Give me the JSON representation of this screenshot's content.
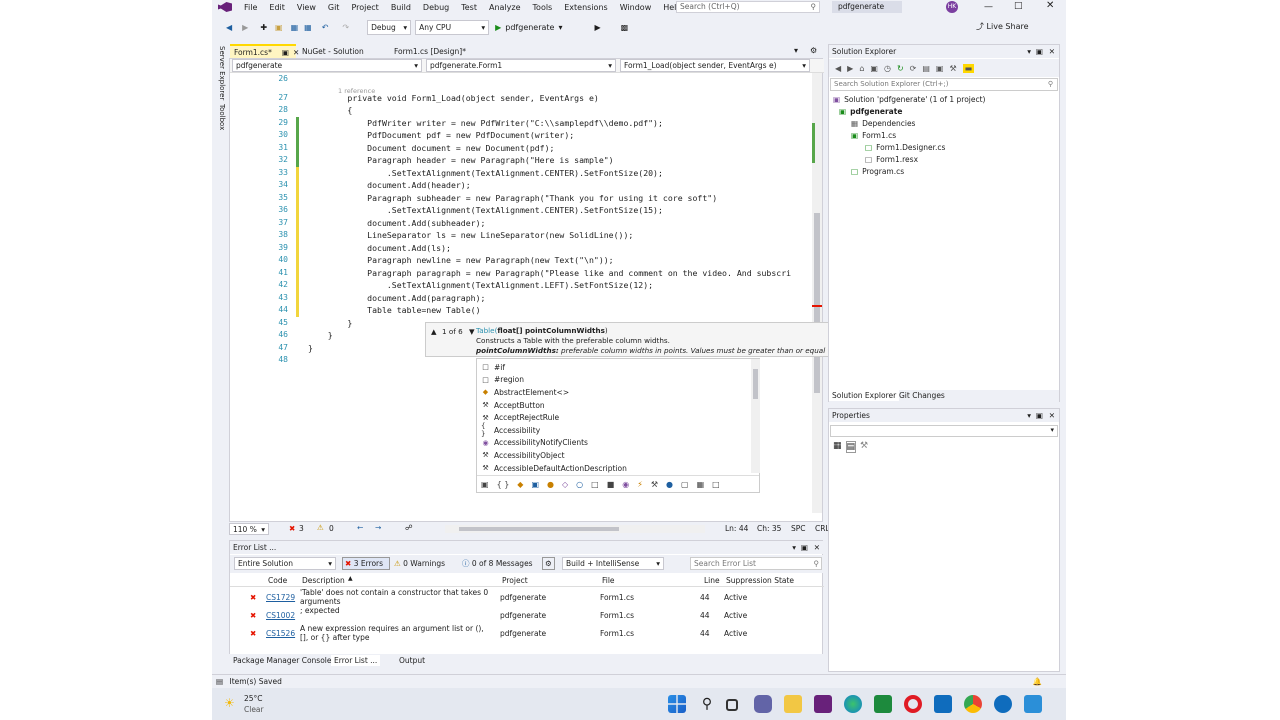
{
  "menu": [
    "File",
    "Edit",
    "View",
    "Git",
    "Project",
    "Build",
    "Debug",
    "Test",
    "Analyze",
    "Tools",
    "Extensions",
    "Window",
    "Help"
  ],
  "search_placeholder": "Search (Ctrl+Q)",
  "solution_name": "pdfgenerate",
  "user_initials": "HK",
  "live_share": "Live Share",
  "toolbar": {
    "config": "Debug",
    "platform": "Any CPU",
    "run_target": "pdfgenerate"
  },
  "side_tabs": {
    "server_explorer": "Server Explorer",
    "toolbox": "Toolbox"
  },
  "doc_tabs": [
    "Form1.cs*",
    "NuGet - Solution",
    "Form1.cs [Design]*"
  ],
  "nav": {
    "project": "pdfgenerate",
    "class": "pdfgenerate.Form1",
    "member": "Form1_Load(object sender, EventArgs e)"
  },
  "code": {
    "ref_hint": "1 reference",
    "lines": [
      {
        "n": "26",
        "t": ""
      },
      {
        "n": "27",
        "t": "        private void Form1_Load(object sender, EventArgs e)"
      },
      {
        "n": "28",
        "t": "        {"
      },
      {
        "n": "29",
        "t": "            PdfWriter writer = new PdfWriter(\"C:\\\\samplepdf\\\\demo.pdf\");"
      },
      {
        "n": "30",
        "t": "            PdfDocument pdf = new PdfDocument(writer);"
      },
      {
        "n": "31",
        "t": "            Document document = new Document(pdf);"
      },
      {
        "n": "32",
        "t": "            Paragraph header = new Paragraph(\"Here is sample\")"
      },
      {
        "n": "33",
        "t": "                .SetTextAlignment(TextAlignment.CENTER).SetFontSize(20);"
      },
      {
        "n": "34",
        "t": "            document.Add(header);"
      },
      {
        "n": "35",
        "t": "            Paragraph subheader = new Paragraph(\"Thank you for using it core soft\")"
      },
      {
        "n": "36",
        "t": "                .SetTextAlignment(TextAlignment.CENTER).SetFontSize(15);"
      },
      {
        "n": "37",
        "t": "            document.Add(subheader);"
      },
      {
        "n": "38",
        "t": "            LineSeparator ls = new LineSeparator(new SolidLine());"
      },
      {
        "n": "39",
        "t": "            document.Add(ls);"
      },
      {
        "n": "40",
        "t": "            Paragraph newline = new Paragraph(new Text(\"\\n\"));"
      },
      {
        "n": "41",
        "t": "            Paragraph paragraph = new Paragraph(\"Please like and comment on the video. And subscri"
      },
      {
        "n": "42",
        "t": "                .SetTextAlignment(TextAlignment.LEFT).SetFontSize(12);"
      },
      {
        "n": "43",
        "t": "            document.Add(paragraph);"
      },
      {
        "n": "44",
        "t": "            Table table=new Table()"
      },
      {
        "n": "45",
        "t": "        }"
      },
      {
        "n": "46",
        "t": "    }"
      },
      {
        "n": "47",
        "t": "}"
      },
      {
        "n": "48",
        "t": ""
      }
    ]
  },
  "tooltip": {
    "counter": "1 of 6",
    "signature_type": "Table(",
    "signature_param": "float[] pointColumnWidths",
    "signature_close": ")",
    "description": "Constructs a Table with the preferable column widths.",
    "param_name": "pointColumnWidths:",
    "param_desc": "preferable column widths in points. Values must be greater than or equal to zero, otherwise it will be interpreted as undefined."
  },
  "autocomplete": [
    "#if",
    "#region",
    "AbstractElement<>",
    "AcceptButton",
    "AcceptRejectRule",
    "Accessibility",
    "AccessibilityNotifyClients",
    "AccessibilityObject",
    "AccessibleDefaultActionDescription"
  ],
  "status": {
    "zoom": "110 %",
    "errors": "3",
    "warnings": "0",
    "ln": "Ln: 44",
    "ch": "Ch: 35",
    "spc": "SPC",
    "crlf": "CRLF"
  },
  "error_list": {
    "title": "Error List ...",
    "scope": "Entire Solution",
    "errors_btn": "3 Errors",
    "warnings_btn": "0 Warnings",
    "messages_btn": "0 of 8 Messages",
    "build_filter": "Build + IntelliSense",
    "search_placeholder": "Search Error List",
    "headers": [
      "Code",
      "Description",
      "Project",
      "File",
      "Line",
      "Suppression State"
    ],
    "rows": [
      {
        "code": "CS1729",
        "desc": "'Table' does not contain a constructor that takes 0 arguments",
        "project": "pdfgenerate",
        "file": "Form1.cs",
        "line": "44",
        "state": "Active"
      },
      {
        "code": "CS1002",
        "desc": "; expected",
        "project": "pdfgenerate",
        "file": "Form1.cs",
        "line": "44",
        "state": "Active"
      },
      {
        "code": "CS1526",
        "desc": "A new expression requires an argument list or (), [], or {} after type",
        "project": "pdfgenerate",
        "file": "Form1.cs",
        "line": "44",
        "state": "Active"
      }
    ],
    "bottom_tabs": [
      "Package Manager Console",
      "Error List ...",
      "Output"
    ]
  },
  "solution_explorer": {
    "title": "Solution Explorer",
    "search_placeholder": "Search Solution Explorer (Ctrl+;)",
    "items": [
      "Solution 'pdfgenerate' (1 of 1 project)",
      "pdfgenerate",
      "Dependencies",
      "Form1.cs",
      "Form1.Designer.cs",
      "Form1.resx",
      "Program.cs"
    ],
    "tabs": [
      "Solution Explorer",
      "Git Changes"
    ]
  },
  "properties": {
    "title": "Properties"
  },
  "statusbar": {
    "saved": "Item(s) Saved"
  },
  "weather": {
    "temp": "25°C",
    "desc": "Clear"
  },
  "colors": {
    "vs_purple": "#68217a",
    "status_bar": "#eef0f6",
    "error_red": "#e51400",
    "selection": "#cce8ff"
  }
}
